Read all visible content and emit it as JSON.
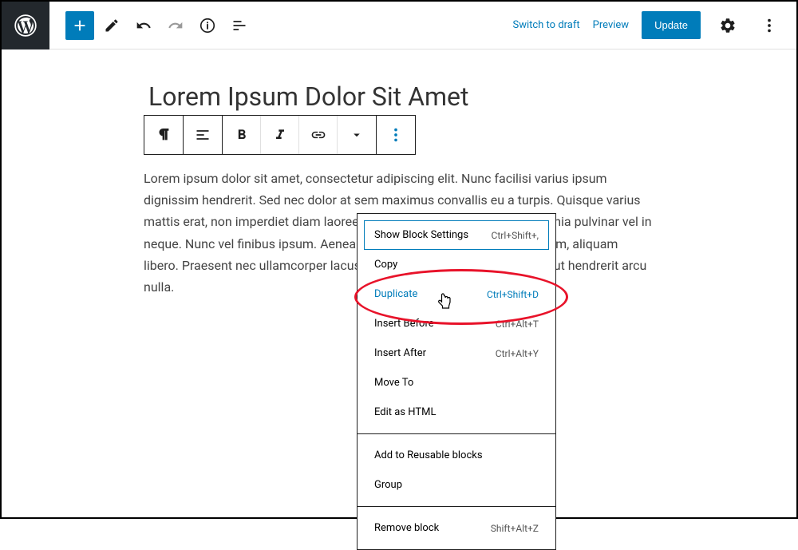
{
  "header": {
    "switch_to_draft": "Switch to draft",
    "preview": "Preview",
    "update": "Update"
  },
  "post": {
    "title": "Lorem Ipsum Dolor Sit Amet",
    "body": "Lorem ipsum dolor sit amet, consectetur adipiscing elit. Nunc facilisi varius ipsum dignissim hendrerit. Sed nec dolor at sem maximus convallis eu a turpis. Quisque varius mattis erat, non imperdiet diam laoreet ac. Proin vulputate arcu justo lacinia pulvinar vel in neque. Nunc vel finibus ipsum. Aenean convallis suscipit lorem elementum, aliquam libero. Praesent nec ullamcorper lacus tristique, erat est pretium magna, ut hendrerit arcu nulla."
  },
  "menu": {
    "show_block_settings": {
      "label": "Show Block Settings",
      "shortcut": "Ctrl+Shift+,"
    },
    "copy": {
      "label": "Copy",
      "shortcut": ""
    },
    "duplicate": {
      "label": "Duplicate",
      "shortcut": "Ctrl+Shift+D"
    },
    "insert_before": {
      "label": "Insert Before",
      "shortcut": "Ctrl+Alt+T"
    },
    "insert_after": {
      "label": "Insert After",
      "shortcut": "Ctrl+Alt+Y"
    },
    "move_to": {
      "label": "Move To",
      "shortcut": ""
    },
    "edit_html": {
      "label": "Edit as HTML",
      "shortcut": ""
    },
    "add_reusable": {
      "label": "Add to Reusable blocks",
      "shortcut": ""
    },
    "group": {
      "label": "Group",
      "shortcut": ""
    },
    "remove": {
      "label": "Remove block",
      "shortcut": "Shift+Alt+Z"
    }
  }
}
